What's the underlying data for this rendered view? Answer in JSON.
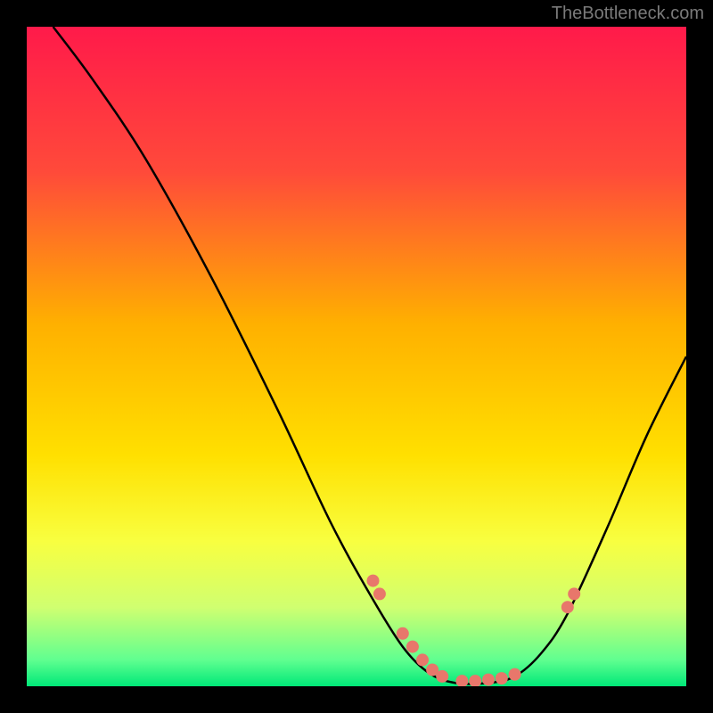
{
  "attribution": "TheBottleneck.com",
  "chart_data": {
    "type": "line",
    "title": "",
    "xlabel": "",
    "ylabel": "",
    "xlim": [
      0,
      100
    ],
    "ylim": [
      0,
      100
    ],
    "gradient_stops": [
      {
        "offset": 0,
        "color": "#ff1a4a"
      },
      {
        "offset": 0.22,
        "color": "#ff4a3a"
      },
      {
        "offset": 0.45,
        "color": "#ffb000"
      },
      {
        "offset": 0.65,
        "color": "#ffe000"
      },
      {
        "offset": 0.78,
        "color": "#f8ff40"
      },
      {
        "offset": 0.88,
        "color": "#d0ff70"
      },
      {
        "offset": 0.96,
        "color": "#60ff90"
      },
      {
        "offset": 1.0,
        "color": "#00e878"
      }
    ],
    "curve": [
      {
        "x": 4,
        "y": 100
      },
      {
        "x": 10,
        "y": 92
      },
      {
        "x": 18,
        "y": 80
      },
      {
        "x": 28,
        "y": 62
      },
      {
        "x": 38,
        "y": 42
      },
      {
        "x": 46,
        "y": 25
      },
      {
        "x": 52,
        "y": 14
      },
      {
        "x": 57,
        "y": 6
      },
      {
        "x": 61,
        "y": 2
      },
      {
        "x": 65,
        "y": 0.5
      },
      {
        "x": 70,
        "y": 0.5
      },
      {
        "x": 74,
        "y": 1.5
      },
      {
        "x": 78,
        "y": 5
      },
      {
        "x": 82,
        "y": 11
      },
      {
        "x": 88,
        "y": 24
      },
      {
        "x": 94,
        "y": 38
      },
      {
        "x": 100,
        "y": 50
      }
    ],
    "scatter_points": [
      {
        "x": 52.5,
        "y": 16
      },
      {
        "x": 53.5,
        "y": 14
      },
      {
        "x": 57,
        "y": 8
      },
      {
        "x": 58.5,
        "y": 6
      },
      {
        "x": 60,
        "y": 4
      },
      {
        "x": 61.5,
        "y": 2.5
      },
      {
        "x": 63,
        "y": 1.5
      },
      {
        "x": 66,
        "y": 0.8
      },
      {
        "x": 68,
        "y": 0.8
      },
      {
        "x": 70,
        "y": 1
      },
      {
        "x": 72,
        "y": 1.2
      },
      {
        "x": 74,
        "y": 1.8
      },
      {
        "x": 82,
        "y": 12
      },
      {
        "x": 83,
        "y": 14
      }
    ],
    "point_color": "#e8776b",
    "curve_color": "#000000"
  }
}
